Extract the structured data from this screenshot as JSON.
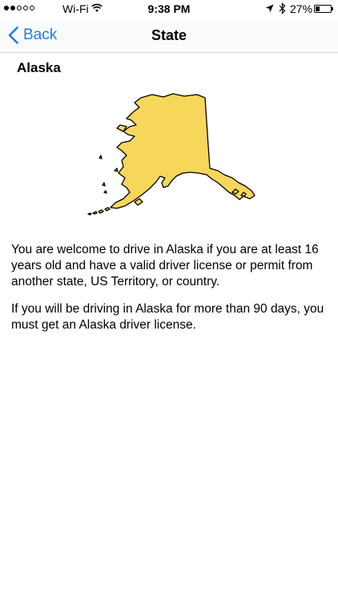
{
  "status_bar": {
    "carrier": "Wi-Fi",
    "time": "9:38 PM",
    "battery_percent": "27%",
    "battery_level": 0.27,
    "signal_bars_filled": 2,
    "signal_bars_total": 5
  },
  "nav": {
    "back_label": "Back",
    "title": "State"
  },
  "content": {
    "state_name": "Alaska",
    "map_color": "#f7d75a",
    "paragraphs": [
      "You are welcome to drive in Alaska if you are at least 16 years old and have a valid driver license or permit from another state, US Territory, or country.",
      "If you will be driving in Alaska for more than 90 days, you must get an Alaska driver license."
    ]
  },
  "colors": {
    "accent": "#1e7cf0"
  }
}
